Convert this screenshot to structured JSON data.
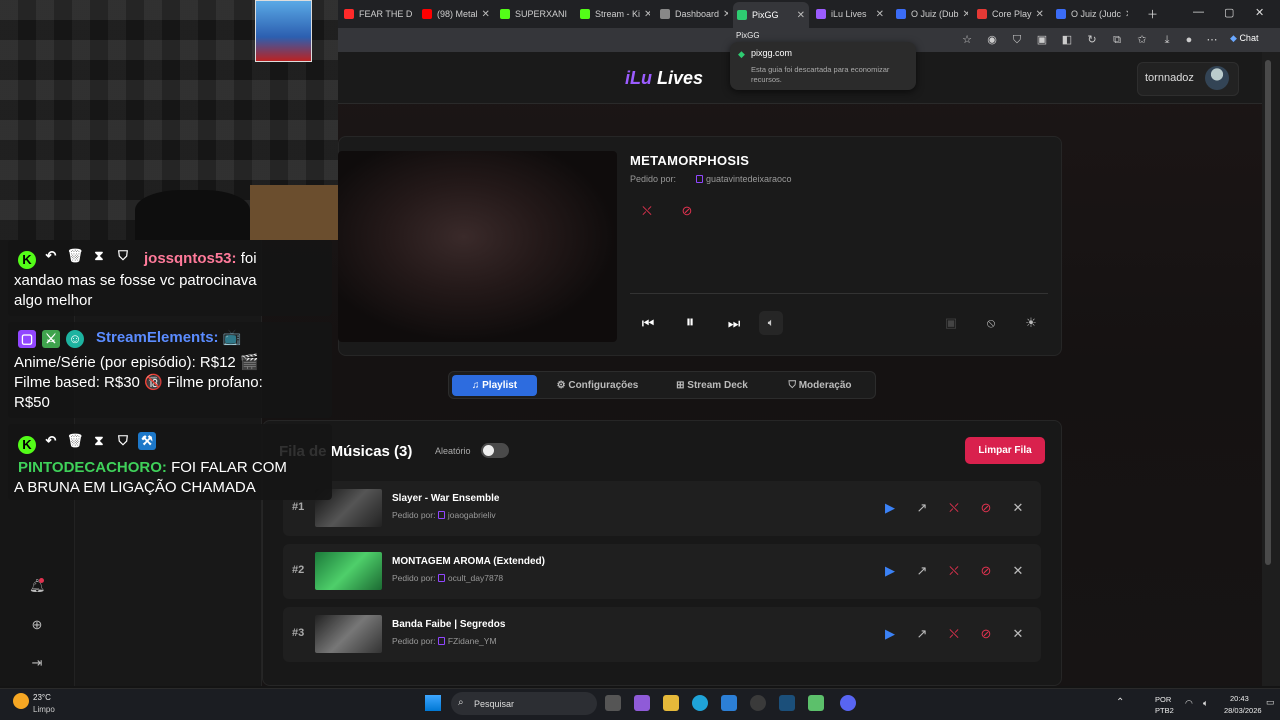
{
  "browser": {
    "tabs": [
      {
        "label": "FEAR THE D",
        "color": "#ff2a2a"
      },
      {
        "label": "(98) Metal",
        "color": "#ff0000"
      },
      {
        "label": "SUPERXANI",
        "color": "#53fc18"
      },
      {
        "label": "Stream - Ki",
        "color": "#53fc18"
      },
      {
        "label": "Dashboard",
        "color": "#888888"
      },
      {
        "label": "PixGG",
        "color": "#2ecc71"
      },
      {
        "label": "iLu Lives",
        "color": "#9b5cff"
      },
      {
        "label": "O Juiz (Dub",
        "color": "#3b6cf6"
      },
      {
        "label": "Core Play",
        "color": "#e53935"
      },
      {
        "label": "O Juiz (Judc",
        "color": "#3b6cf6"
      }
    ],
    "chat_button": "Chat",
    "tooltip": {
      "small_title": "PixGG",
      "domain": "pixgg.com",
      "note": "Esta guia foi descartada para economizar recursos."
    }
  },
  "app": {
    "logo_a": "iLu",
    "logo_b": " Lives",
    "username": "tornnadoz"
  },
  "player": {
    "title": "METAMORPHOSIS",
    "requested_label": "Pedido por:",
    "requested_by": "guatavintedeixaraoco"
  },
  "tabs": [
    {
      "label": "♫ Playlist",
      "active": true
    },
    {
      "label": "⚙ Configurações",
      "active": false
    },
    {
      "label": "⊞ Stream Deck",
      "active": false
    },
    {
      "label": "⛉ Moderação",
      "active": false
    }
  ],
  "queue": {
    "title": "Fila de Músicas (3)",
    "shuffle_label": "Aleatório",
    "shuffle_on": false,
    "clear_button": "Limpar Fila",
    "items": [
      {
        "num": "#1",
        "title": "Slayer - War Ensemble",
        "requested_label": "Pedido por:",
        "user": "joaogabrieliv",
        "thumb": "#3a3a3a"
      },
      {
        "num": "#2",
        "title": "MONTAGEM AROMA (Extended)",
        "requested_label": "Pedido por:",
        "user": "ocult_day7878",
        "thumb": "#2fa65a"
      },
      {
        "num": "#3",
        "title": "Banda Faibe | Segredos",
        "requested_label": "Pedido por:",
        "user": "FZidane_YM",
        "thumb": "#4a4a4a"
      }
    ]
  },
  "chat": [
    {
      "name": "jossqntos53:",
      "name_color": "#ff7a9a",
      "text1": " foi",
      "lines": [
        "xandao mas se fosse vc patrocinava",
        "algo melhor"
      ]
    },
    {
      "name": "StreamElements:",
      "name_color": "#5b8cff",
      "text1": " 📺",
      "lines": [
        "Anime/Série (por episódio): R$12 🎬",
        "Filme based: R$30 🔞 Filme profano:",
        "R$50"
      ]
    },
    {
      "name": "PINTODECACHORO:",
      "name_color": "#3fd15a",
      "text1": " FOI FALAR COM",
      "lines": [
        "A BRUNA EM LIGAÇÃO CHAMADA"
      ]
    }
  ],
  "taskbar": {
    "temp": "23°C",
    "condition": "Limpo",
    "search": "Pesquisar",
    "lang1": "POR",
    "lang2": "PTB2",
    "time": "20:43",
    "date": "28/03/2026"
  }
}
